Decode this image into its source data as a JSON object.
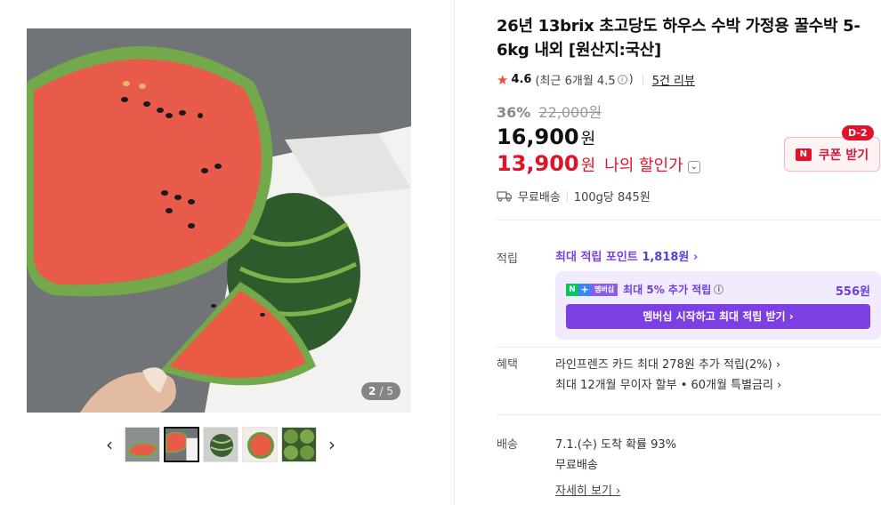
{
  "gallery": {
    "counter_current": "2",
    "counter_total": "/ 5",
    "prev_arrow": "‹",
    "next_arrow": "›"
  },
  "product": {
    "title": "26년 13brix 초고당도 하우스 수박 가정용 꿀수박 5-6kg 내외 [원산지:국산]",
    "rating_star": "★",
    "rating_score": "4.6",
    "rating_recent": "(최근 6개월 4.5",
    "rating_recent_close": ")",
    "review_link": "5건 리뷰",
    "discount_rate": "36%",
    "original_price": "22,000원",
    "price": "16,900",
    "price_unit": "원",
    "my_price": "13,900",
    "my_price_unit": "원",
    "my_price_label": "나의 할인가",
    "coupon_badge": "D-2",
    "coupon_label": "쿠폰 받기",
    "coupon_icon_text": "N",
    "shipping": "무료배송",
    "unit_price": "100g당 845원"
  },
  "points": {
    "label": "적립",
    "max_points_text": "최대 적립 포인트",
    "max_points_amount": "1,818원",
    "membership_icon_text": "멤버십",
    "membership_text": "최대 5% 추가 적립",
    "membership_amount": "556원",
    "membership_button": "멤버십 시작하고 최대 적립 받기 ›"
  },
  "benefits": {
    "label": "혜택",
    "line1": "라인프렌즈 카드 최대 278원 추가 적립(2%) ›",
    "line2": "최대 12개월 무이자 할부 • 60개월 특별금리 ›"
  },
  "delivery": {
    "label": "배송",
    "arrival": "7.1.(수) 도착 확률 93%",
    "fee": "무료배송",
    "detail_link": "자세히 보기 ›"
  },
  "colors": {
    "accent_red": "#e0132b",
    "accent_purple": "#7b3fe4",
    "star": "#f04b3a"
  }
}
